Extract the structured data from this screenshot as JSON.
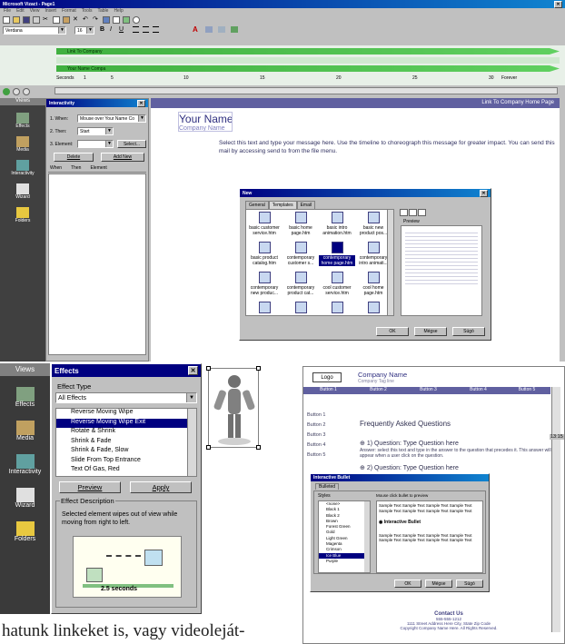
{
  "app": {
    "title": "Microsoft Vizact - Page1"
  },
  "menu": [
    "File",
    "Edit",
    "View",
    "Insert",
    "Format",
    "Tools",
    "Table",
    "Help"
  ],
  "format_bar": {
    "font": "Verdana",
    "size": "16",
    "bold": "B",
    "italic": "I",
    "underline": "U"
  },
  "timeline": {
    "tracks": [
      "Link To Company",
      "Your Name Compa"
    ],
    "seconds_label": "Seconds",
    "ticks": [
      "1",
      "5",
      "10",
      "15",
      "20",
      "25",
      "30"
    ],
    "forever": "Forever"
  },
  "views_panel": {
    "title": "Views",
    "items": [
      "Effects",
      "Media",
      "Interactivity",
      "Wizard",
      "Folders"
    ]
  },
  "interactivity_panel": {
    "title": "Interactivity",
    "when_label": "1. When:",
    "when_value": "Mouse over Your Name Co",
    "then_label": "2. Then:",
    "then_value": "Start",
    "element_label": "3. Element:",
    "select_button": "Select...",
    "delete_button": "Delete",
    "add_new_button": "Add New",
    "columns": [
      "When",
      "Then",
      "Element"
    ]
  },
  "page": {
    "header_link": "Link To Company Home Page",
    "name": "Your Name",
    "company": "Company Name",
    "message": "Select this text and type your message here.  Use the timeline to choreograph this message for greater impact.  You can send this mail by accessing send to from the file menu."
  },
  "new_dialog": {
    "title": "New",
    "tabs": [
      "General",
      "Templates",
      "Email"
    ],
    "templates": [
      "basic customer service.htm",
      "basic home page.htm",
      "basic intro animation.htm",
      "basic new product pos...",
      "basic product catalog.htm",
      "contemporary customer s...",
      "contemporary home page.htm",
      "contemporary intro animati...",
      "contemporary new produc...",
      "contemporary product cat...",
      "cool customer service.htm",
      "cool home page.htm",
      "",
      "",
      "",
      ""
    ],
    "preview_label": "Preview",
    "ok": "OK",
    "cancel": "Mégse",
    "help": "Súgó"
  },
  "views_panel2": {
    "title": "Views",
    "items": [
      "Effects",
      "Media",
      "Interactivity",
      "Wizard",
      "Folders"
    ]
  },
  "effects_panel": {
    "title": "Effects",
    "type_label": "Effect Type",
    "type_value": "All Effects",
    "list": [
      "Reverse Moving Wipe",
      "Reverse Moving Wipe Exit",
      "Rotate & Shrink",
      "Shrink & Fade",
      "Shrink & Fade, Slow",
      "Slide From Top Entrance",
      "Text Of Gas, Red"
    ],
    "selected_index": 1,
    "preview_button": "Preview",
    "apply_button": "Apply",
    "desc_label": "Effect Description",
    "desc_text": "Selected element wipes out of view while moving from right to left.",
    "duration": "2.5 seconds"
  },
  "faq_page": {
    "logo": "Logo",
    "company": "Company Name",
    "tagline": "Company Tag line",
    "nav": [
      "Button 1",
      "Button 2",
      "Button 3",
      "Button 4",
      "Button 5"
    ],
    "side_buttons": [
      "Button 1",
      "Button 2",
      "Button 3",
      "Button 4",
      "Button 5"
    ],
    "heading": "Frequently Asked Questions",
    "q1": "1) Question: Type Question here",
    "answer": "Answer: select this text and type in the answer to the question that precedes it. This answer will appear when a user click on the question.",
    "q2": "2) Question: Type Question here",
    "contact_title": "Contact Us",
    "contact_lines": [
      "555-555-1212",
      "1111 Street Address Here City, State Zip Code",
      "Copyright Company Name Here. All Rights Reserved."
    ],
    "clock": "13:15"
  },
  "bullet_dialog": {
    "title": "Interactive Bullet",
    "tab": "Bulleted",
    "styles_label": "Styles",
    "styles": [
      "<none>",
      "Black 1",
      "Black 2",
      "Brown",
      "Forest Green",
      "Gold",
      "Light Green",
      "Magenta",
      "Crimson",
      "Ice Blue",
      "Purple"
    ],
    "selected_index": 9,
    "preview_label": "Mouse click bullet to preview",
    "sample": "Sample Text Sample Text Sample Text Sample Text Sample Text Sample Text Sample Text Sample Text",
    "bullet_label": "Interactive Bullet",
    "ok": "OK",
    "cancel": "Mégse",
    "help": "Súgó"
  },
  "caption": "hatunk linkeket is, vagy videoleját-"
}
